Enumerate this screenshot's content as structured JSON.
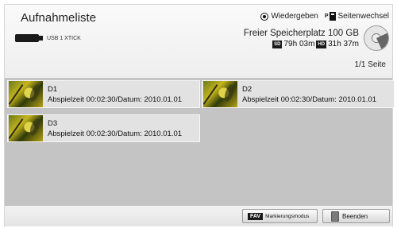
{
  "header": {
    "title": "Aufnahmeliste",
    "usb_label": "USB 1 XTICK",
    "legend": {
      "play_label": "Wiedergeben",
      "page_prefix": "P",
      "page_label": "Seitenwechsel"
    },
    "storage": {
      "free_space": "Freier Speicherplatz 100 GB",
      "sd_badge": "SD",
      "sd_time": "79h 03m",
      "hd_badge": "HD",
      "hd_time": "31h 37m"
    },
    "page_counter": "1/1 Seite"
  },
  "recordings": [
    {
      "name": "D1",
      "info": "Abspielzeit 00:02:30/Datum: 2010.01.01"
    },
    {
      "name": "D2",
      "info": "Abspielzeit 00:02:30/Datum: 2010.01.01"
    },
    {
      "name": "D3",
      "info": "Abspielzeit 00:02:30/Datum: 2010.01.01"
    }
  ],
  "footer": {
    "fav_badge": "FAV",
    "fav_label": "Markierungsmodus",
    "exit_label": "Beenden"
  }
}
